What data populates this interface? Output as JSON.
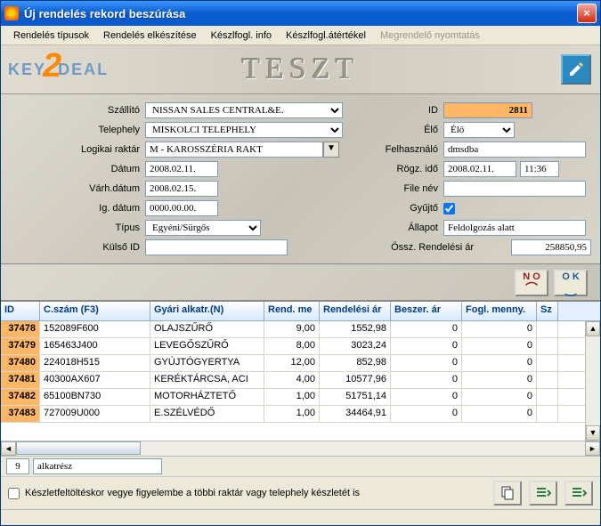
{
  "window": {
    "title": "Új rendelés rekord beszúrása"
  },
  "menu": {
    "m1": "Rendelés típusok",
    "m2": "Rendelés elkészítése",
    "m3": "Készlfogl. info",
    "m4": "Készlfogl.átértékel",
    "m5": "Megrendelő nyomtatás"
  },
  "logo": {
    "part1": "KEY",
    "part2": "2",
    "part3": "DEAL"
  },
  "brand": "TESZT",
  "labels": {
    "szallito": "Szállító",
    "telephely": "Telephely",
    "lograktar": "Logikai raktár",
    "datum": "Dátum",
    "varhdatum": "Várh.dátum",
    "igdatum": "Ig. dátum",
    "tipus": "Típus",
    "kulsoid": "Külső ID",
    "id": "ID",
    "elo": "Élő",
    "felhasznalo": "Felhasználó",
    "rogzido": "Rögz. idő",
    "filenev": "File név",
    "gyujto": "Gyűjtő",
    "allapot": "Állapot",
    "osszar": "Össz. Rendelési ár"
  },
  "values": {
    "szallito": "NISSAN SALES CENTRAL&E.",
    "telephely": "MISKOLCI TELEPHELY",
    "lograktar": "M - KAROSSZÉRIA RAKT",
    "datum": "2008.02.11.",
    "varhdatum": "2008.02.15.",
    "igdatum": "0000.00.00.",
    "tipus": "Egyéni/Sürgős",
    "kulsoid": "",
    "id": "2811",
    "elo": "Élő",
    "felhasznalo": "dmsdba",
    "rogz_d": "2008.02.11.",
    "rogz_t": "11:36",
    "filenev": "",
    "allapot": "Feldolgozás alatt",
    "osszar": "258850,95"
  },
  "buttons": {
    "no": "N O",
    "ok": "O K"
  },
  "grid": {
    "headers": {
      "id": "ID",
      "cs": "C.szám (F3)",
      "ga": "Gyári alkatr.(N)",
      "rm": "Rend. me",
      "ra": "Rendelési ár",
      "ba": "Beszer. ár",
      "fm": "Fogl. menny.",
      "sz": "Sz"
    },
    "rows": [
      {
        "id": "37478",
        "cs": "152089F600",
        "ga": "OLAJSZŰRŐ",
        "rm": "9,00",
        "ra": "1552,98",
        "ba": "0",
        "fm": "0"
      },
      {
        "id": "37479",
        "cs": "165463J400",
        "ga": "LEVEGŐSZŰRŐ",
        "rm": "8,00",
        "ra": "3023,24",
        "ba": "0",
        "fm": "0"
      },
      {
        "id": "37480",
        "cs": "224018H515",
        "ga": "GYÚJTÓGYERTYA",
        "rm": "12,00",
        "ra": "852,98",
        "ba": "0",
        "fm": "0"
      },
      {
        "id": "37481",
        "cs": "40300AX607",
        "ga": "KERÉKTÁRCSA, ACI",
        "rm": "4,00",
        "ra": "10577,96",
        "ba": "0",
        "fm": "0"
      },
      {
        "id": "37482",
        "cs": "65100BN730",
        "ga": "MOTORHÁZTETŐ",
        "rm": "1,00",
        "ra": "51751,14",
        "ba": "0",
        "fm": "0"
      },
      {
        "id": "37483",
        "cs": "727009U000",
        "ga": "E.SZÉLVÉDŐ",
        "rm": "1,00",
        "ra": "34464,91",
        "ba": "0",
        "fm": "0"
      }
    ]
  },
  "footer": {
    "count": "9",
    "part": "alkatrész",
    "checkbox_label": "Készletfeltöltéskor vegye figyelembe a többi raktár vagy telephely készletét is"
  }
}
